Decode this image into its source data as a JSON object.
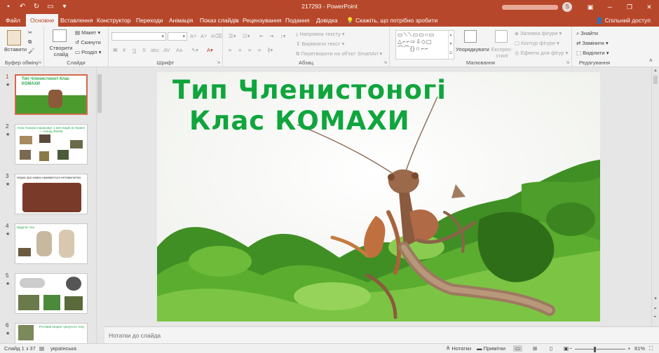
{
  "window": {
    "title": "217293 - PowerPoint",
    "avatar_initial": "S",
    "share": "Спільний доступ",
    "tell_me": "Скажіть, що потрібно зробити"
  },
  "tabs": [
    {
      "label": "Файл",
      "active": false
    },
    {
      "label": "Основне",
      "active": true
    },
    {
      "label": "Вставлення",
      "active": false
    },
    {
      "label": "Конструктор",
      "active": false
    },
    {
      "label": "Переходи",
      "active": false
    },
    {
      "label": "Анімація",
      "active": false
    },
    {
      "label": "Показ слайдів",
      "active": false
    },
    {
      "label": "Рецензування",
      "active": false
    },
    {
      "label": "Подання",
      "active": false
    },
    {
      "label": "Довідка",
      "active": false
    }
  ],
  "ribbon": {
    "clipboard": {
      "label": "Буфер обміну",
      "paste": "Вставити"
    },
    "slides": {
      "label": "Слайди",
      "new_slide": "Створити слайд",
      "layout": "Макет",
      "reset": "Скинути",
      "section": "Розділ"
    },
    "font": {
      "label": "Шрифт",
      "bold": "Ж",
      "italic": "К",
      "underline": "Ч",
      "strike": "S",
      "shadow": "abc",
      "spacing": "AV",
      "case": "Aa"
    },
    "paragraph": {
      "label": "Абзац",
      "text_direction": "Напрямок тексту",
      "align_text": "Вирівняти текст",
      "smartart": "Перетворити на об'єкт SmartArt"
    },
    "drawing": {
      "label": "Малювання",
      "arrange": "Упорядкувати",
      "quick_styles": "Експрес-стилі",
      "fill": "Заливка фігури",
      "outline": "Контур фігури",
      "effects": "Ефекти для фігур"
    },
    "editing": {
      "label": "Редагування",
      "find": "Знайти",
      "replace": "Замінити",
      "select": "Виділити"
    }
  },
  "thumbnails": [
    {
      "num": "1",
      "title": "Тип Членистоногі Клас КОМАХИ",
      "active": true
    },
    {
      "num": "2",
      "title": "Клас Комахи нараховує 1 млн видів (в Україні — понад 35000)",
      "active": false
    },
    {
      "num": "3",
      "title": "Наука про комах називається ентомологією",
      "active": false
    },
    {
      "num": "4",
      "title": "Відділи тіла",
      "active": false
    },
    {
      "num": "5",
      "title": "",
      "active": false
    },
    {
      "num": "6",
      "title": "Ротовий апарат гризучого типу",
      "active": false
    }
  ],
  "slide": {
    "title_line1": "Тип Членистоногі",
    "title_line2": "Клас КОМАХИ",
    "title_color": "#10a53d"
  },
  "notes_placeholder": "Нотатки до слайда",
  "status": {
    "slide_pos": "Слайд 1 з 37",
    "language": "українська",
    "notes_btn": "Нотатки",
    "comments_btn": "Примітки",
    "zoom": "81%",
    "zoom_level": 0.81
  },
  "colors": {
    "accent": "#b7472a",
    "ribbon_bg": "#f4f4f4"
  }
}
